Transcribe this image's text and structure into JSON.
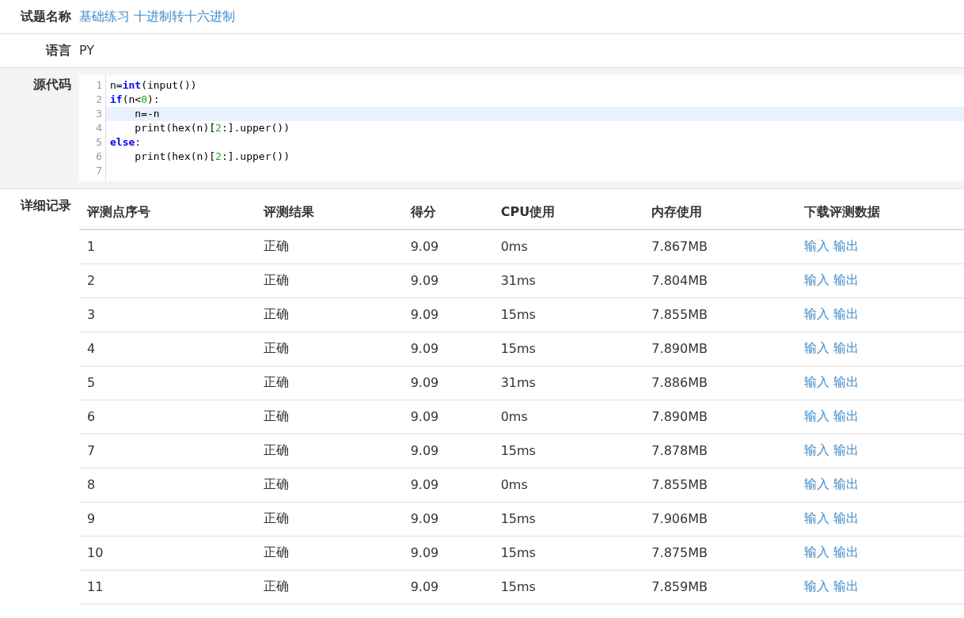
{
  "problem": {
    "label": "试题名称",
    "value": "基础练习 十进制转十六进制"
  },
  "language": {
    "label": "语言",
    "value": "PY"
  },
  "source": {
    "label": "源代码",
    "lines": [
      {
        "number": "1",
        "highlighted": false,
        "tokens": [
          {
            "kind": "plain",
            "text": "n="
          },
          {
            "kind": "keyword",
            "text": "int"
          },
          {
            "kind": "plain",
            "text": "(input())"
          }
        ]
      },
      {
        "number": "2",
        "highlighted": false,
        "tokens": [
          {
            "kind": "keyword",
            "text": "if"
          },
          {
            "kind": "plain",
            "text": "(n<"
          },
          {
            "kind": "number",
            "text": "0"
          },
          {
            "kind": "plain",
            "text": "):"
          }
        ]
      },
      {
        "number": "3",
        "highlighted": true,
        "tokens": [
          {
            "kind": "plain",
            "text": "    n=-n"
          }
        ]
      },
      {
        "number": "4",
        "highlighted": false,
        "tokens": [
          {
            "kind": "plain",
            "text": "    print(hex(n)["
          },
          {
            "kind": "number",
            "text": "2"
          },
          {
            "kind": "plain",
            "text": ":].upper())"
          }
        ]
      },
      {
        "number": "5",
        "highlighted": false,
        "tokens": [
          {
            "kind": "keyword",
            "text": "else"
          },
          {
            "kind": "plain",
            "text": ":"
          }
        ]
      },
      {
        "number": "6",
        "highlighted": false,
        "tokens": [
          {
            "kind": "plain",
            "text": "    print(hex(n)["
          },
          {
            "kind": "number",
            "text": "2"
          },
          {
            "kind": "plain",
            "text": ":].upper())"
          }
        ]
      },
      {
        "number": "7",
        "highlighted": false
      }
    ]
  },
  "details": {
    "label": "详细记录",
    "table": {
      "columns": [
        "评测点序号",
        "评测结果",
        "得分",
        "CPU使用",
        "内存使用",
        "下载评测数据"
      ],
      "rows": [
        {
          "index": "1",
          "result": "正确",
          "score": "9.09",
          "cpu": "0ms",
          "memory": "7.867MB",
          "input_link": "输入",
          "output_link": "输出"
        },
        {
          "index": "2",
          "result": "正确",
          "score": "9.09",
          "cpu": "31ms",
          "memory": "7.804MB",
          "input_link": "输入",
          "output_link": "输出"
        },
        {
          "index": "3",
          "result": "正确",
          "score": "9.09",
          "cpu": "15ms",
          "memory": "7.855MB",
          "input_link": "输入",
          "output_link": "输出"
        },
        {
          "index": "4",
          "result": "正确",
          "score": "9.09",
          "cpu": "15ms",
          "memory": "7.890MB",
          "input_link": "输入",
          "output_link": "输出"
        },
        {
          "index": "5",
          "result": "正确",
          "score": "9.09",
          "cpu": "31ms",
          "memory": "7.886MB",
          "input_link": "输入",
          "output_link": "输出"
        },
        {
          "index": "6",
          "result": "正确",
          "score": "9.09",
          "cpu": "0ms",
          "memory": "7.890MB",
          "input_link": "输入",
          "output_link": "输出"
        },
        {
          "index": "7",
          "result": "正确",
          "score": "9.09",
          "cpu": "15ms",
          "memory": "7.878MB",
          "input_link": "输入",
          "output_link": "输出"
        },
        {
          "index": "8",
          "result": "正确",
          "score": "9.09",
          "cpu": "0ms",
          "memory": "7.855MB",
          "input_link": "输入",
          "output_link": "输出"
        },
        {
          "index": "9",
          "result": "正确",
          "score": "9.09",
          "cpu": "15ms",
          "memory": "7.906MB",
          "input_link": "输入",
          "output_link": "输出"
        },
        {
          "index": "10",
          "result": "正确",
          "score": "9.09",
          "cpu": "15ms",
          "memory": "7.875MB",
          "input_link": "输入",
          "output_link": "输出"
        },
        {
          "index": "11",
          "result": "正确",
          "score": "9.09",
          "cpu": "15ms",
          "memory": "7.859MB",
          "input_link": "输入",
          "output_link": "输出"
        }
      ]
    }
  }
}
